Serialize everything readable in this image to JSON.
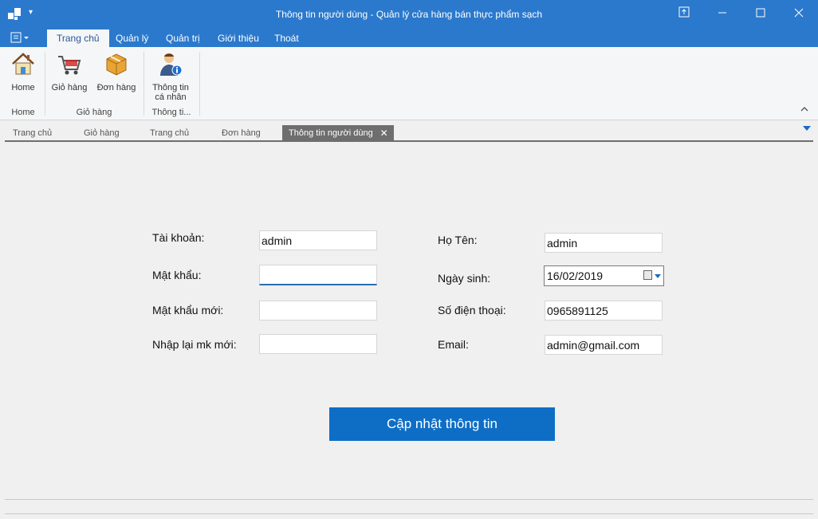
{
  "window": {
    "title": "Thông tin người dùng - Quản lý cửa hàng bán thực phẩm sạch",
    "quick_access_arrow": "▾",
    "app_icon": "app-logo-icon",
    "controls": [
      "restore-down-icon",
      "minimize-icon",
      "maximize-icon",
      "close-icon"
    ]
  },
  "ribbon": {
    "tabs": [
      {
        "label": "Trang chủ",
        "active": true
      },
      {
        "label": "Quản lý"
      },
      {
        "label": "Quản trị"
      },
      {
        "label": "Giới thiệu"
      },
      {
        "label": "Thoát"
      }
    ],
    "buttons": {
      "home": "Home",
      "cart": "Giỏ hàng",
      "order": "Đơn hàng",
      "user_info_line1": "Thông tin",
      "user_info_line2": "cá nhân"
    },
    "groups": {
      "home": "Home",
      "cart": "Giỏ hàng",
      "info": "Thông ti..."
    }
  },
  "doc_tabs": [
    {
      "label": "Trang chủ"
    },
    {
      "label": "Giỏ hàng"
    },
    {
      "label": "Trang chủ"
    },
    {
      "label": "Đơn hàng"
    },
    {
      "label": "Thông tin người dùng",
      "active": true
    }
  ],
  "form": {
    "account_label": "Tài khoản:",
    "account_value": "admin",
    "password_label": "Mật khẩu:",
    "password_value": "",
    "new_password_label": "Mật khẩu mới:",
    "new_password_value": "",
    "confirm_password_label": "Nhập lại mk mới:",
    "confirm_password_value": "",
    "fullname_label": "Họ Tên:",
    "fullname_value": "admin",
    "birthday_label": "Ngày sinh:",
    "birthday_value": "16/02/2019",
    "phone_label": "Số điện thoại:",
    "phone_value": "0965891125",
    "email_label": "Email:",
    "email_value": "admin@gmail.com",
    "update_button": "Cập nhật thông tin"
  },
  "colors": {
    "titlebar": "#2b79cc",
    "button": "#0e6ec6",
    "active_doc_tab": "#6e6e6e"
  }
}
